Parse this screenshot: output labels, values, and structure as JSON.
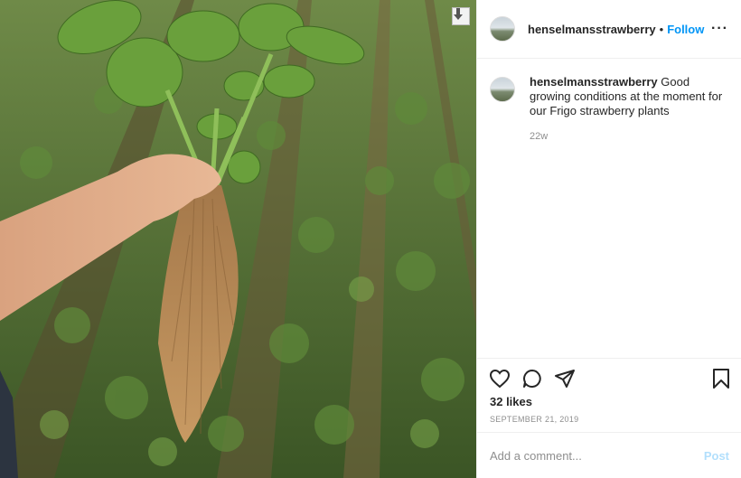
{
  "post": {
    "username": "henselmansstrawberry",
    "separator": "•",
    "follow_label": "Follow",
    "more_icon": "more-options-icon",
    "caption_user": "henselmansstrawberry",
    "caption": "Good growing conditions at the moment for our Frigo strawberry plants",
    "time_ago": "22w",
    "likes": "32 likes",
    "date": "SEPTEMBER 21, 2019"
  },
  "actions": {
    "icons": [
      "heart-icon",
      "comment-icon",
      "share-icon",
      "bookmark-icon"
    ]
  },
  "comment": {
    "placeholder": "Add a comment...",
    "post_label": "Post"
  },
  "colors": {
    "accent": "#0095f6",
    "post_disabled": "#b2dffc",
    "muted": "#8e8e8e"
  }
}
